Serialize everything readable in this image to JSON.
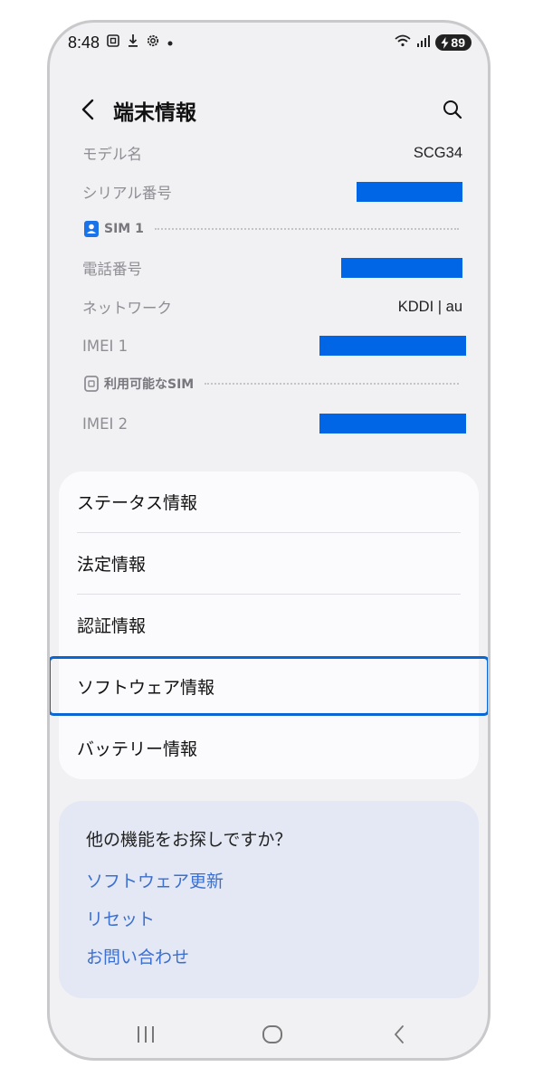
{
  "status_bar": {
    "time": "8:48",
    "battery_level": "89",
    "icons": [
      "screenshot-icon",
      "download-icon",
      "settings-icon",
      "notification-dot-icon",
      "wifi-icon",
      "signal-icon",
      "charging-icon"
    ]
  },
  "header": {
    "title": "端末情報",
    "back_icon": "back-arrow-icon",
    "search_icon": "search-icon"
  },
  "info": {
    "model_label": "モデル名",
    "model_value": "SCG34",
    "serial_label": "シリアル番号",
    "sim1_section": "SIM 1",
    "phone_label": "電話番号",
    "network_label": "ネットワーク",
    "network_value": "KDDI | au",
    "imei1_label": "IMEI 1",
    "available_sim_section": "利用可能なSIM",
    "imei2_label": "IMEI 2"
  },
  "menu": {
    "items": [
      {
        "label": "ステータス情報"
      },
      {
        "label": "法定情報"
      },
      {
        "label": "認証情報"
      },
      {
        "label": "ソフトウェア情報",
        "selected": true
      },
      {
        "label": "バッテリー情報"
      }
    ]
  },
  "suggest": {
    "title": "他の機能をお探しですか？",
    "links": [
      {
        "label": "ソフトウェア更新"
      },
      {
        "label": "リセット"
      },
      {
        "label": "お問い合わせ"
      }
    ]
  },
  "colors": {
    "accent": "#0a66d4",
    "link": "#3b6fd0",
    "redaction": "#0066e6"
  }
}
